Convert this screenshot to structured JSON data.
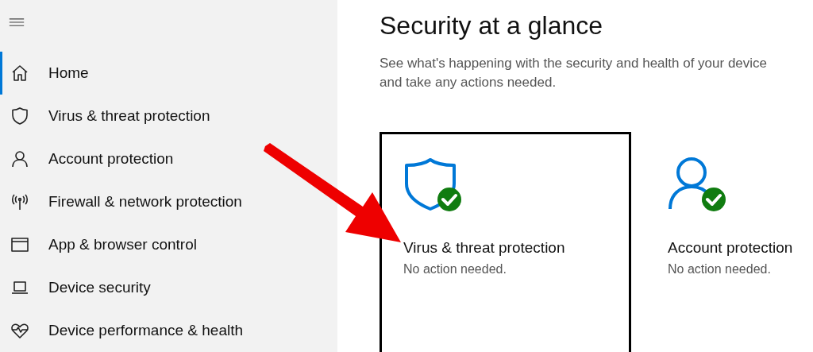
{
  "nav": [
    {
      "label": "Home",
      "kind": "home",
      "selected": true
    },
    {
      "label": "Virus & threat protection",
      "kind": "shield",
      "selected": false
    },
    {
      "label": "Account protection",
      "kind": "person",
      "selected": false
    },
    {
      "label": "Firewall & network protection",
      "kind": "antenna",
      "selected": false
    },
    {
      "label": "App & browser control",
      "kind": "window",
      "selected": false
    },
    {
      "label": "Device security",
      "kind": "laptop",
      "selected": false
    },
    {
      "label": "Device performance & health",
      "kind": "heart",
      "selected": false
    }
  ],
  "title": "Security at a glance",
  "description": "See what's happening with the security and health of your device and take any actions needed.",
  "cards": [
    {
      "title": "Virus & threat protection",
      "status": "No action needed.",
      "kind": "shield",
      "selected": true
    },
    {
      "title": "Account protection",
      "status": "No action needed.",
      "kind": "person",
      "selected": false
    }
  ]
}
